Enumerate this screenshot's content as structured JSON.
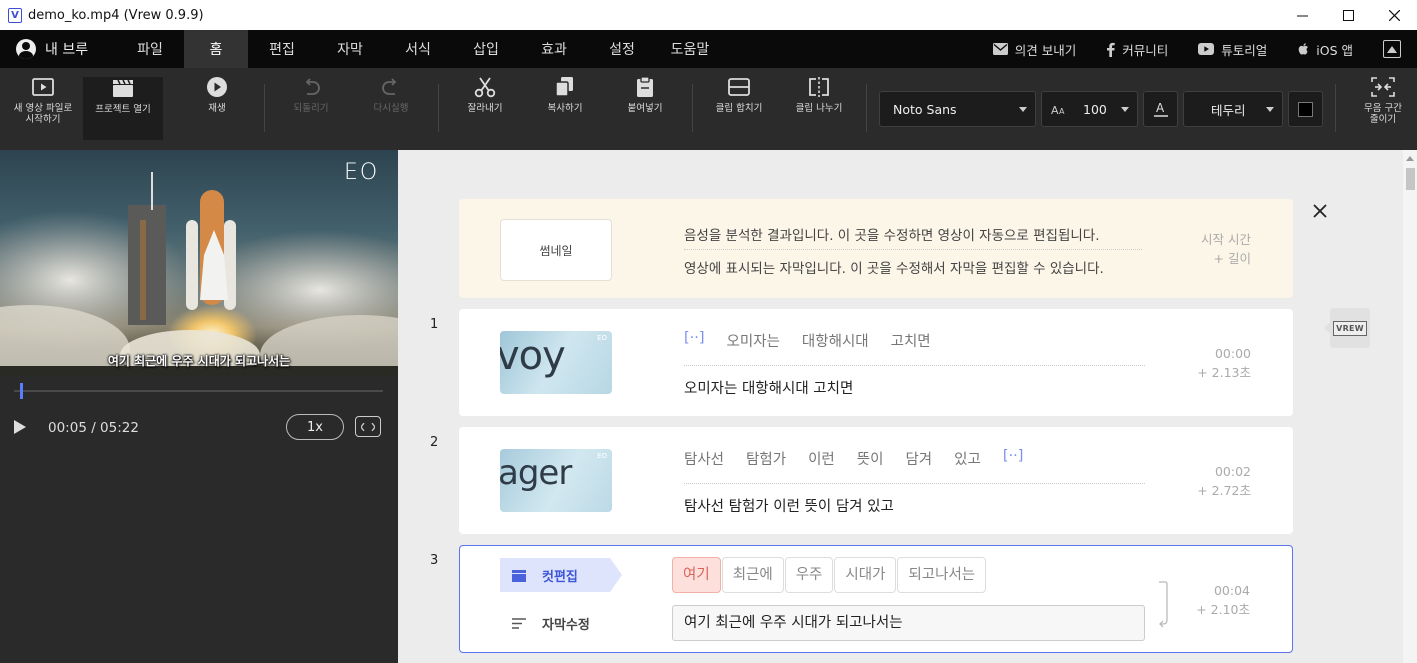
{
  "window": {
    "title": "demo_ko.mp4 (Vrew 0.9.9)",
    "app_icon_letter": "V"
  },
  "menubar": {
    "user_label": "내 브루",
    "items": [
      "파일",
      "홈",
      "편집",
      "자막",
      "서식",
      "삽입",
      "효과",
      "설정",
      "도움말"
    ],
    "active_item": "홈",
    "links": {
      "feedback": "의견 보내기",
      "community": "커뮤니티",
      "tutorial": "튜토리얼",
      "ios_app": "iOS 앱"
    }
  },
  "toolbar": {
    "new_video_line1": "새 영상 파일로",
    "new_video_line2": "시작하기",
    "open_project": "프로젝트 열기",
    "play": "재생",
    "undo": "되돌리기",
    "redo": "다시실행",
    "cut": "잘라내기",
    "copy": "복사하기",
    "paste": "붙여넣기",
    "merge_clip": "클립 합치기",
    "split_clip": "클립 나누기",
    "font_name": "Noto Sans",
    "font_size": "100",
    "outline_label": "테두리",
    "reduce_silence_line1": "무음 구간",
    "reduce_silence_line2": "줄이기"
  },
  "preview": {
    "logo": "EO",
    "subtitle_overlay": "여기 최근에 우주 시대가 되고나서는",
    "time": "00:05 / 05:22",
    "speed": "1x",
    "progress": 0.016
  },
  "editor": {
    "header": {
      "thumbnail_label": "썸네일",
      "line1": "음성을 분석한 결과입니다. 이 곳을 수정하면 영상이 자동으로 편집됩니다.",
      "line2": "영상에 표시되는 자막입니다. 이 곳을 수정해서 자막을 편집할 수 있습니다.",
      "meta_start": "시작 시간",
      "meta_length": "+ 길이"
    },
    "side_badge": "VREW",
    "clips": [
      {
        "number": "1",
        "thumb_text": "voy",
        "thumb_logo": "EO",
        "words": [
          "[··]",
          "오미자는",
          "대항해시대",
          "고치면"
        ],
        "subtitle": "오미자는 대항해시대 고치면",
        "start": "00:00",
        "length": "+ 2.13초"
      },
      {
        "number": "2",
        "thumb_text": "ager",
        "thumb_logo": "EO",
        "words": [
          "탐사선",
          "탐험가",
          "이런",
          "뜻이",
          "담겨",
          "있고",
          "[··]"
        ],
        "subtitle": "탐사선 탐험가 이런 뜻이 담겨 있고",
        "start": "00:02",
        "length": "+ 2.72초"
      },
      {
        "number": "3",
        "cut_edit_label": "컷편집",
        "subtitle_edit_label": "자막수정",
        "words": [
          "여기",
          "최근에",
          "우주",
          "시대가",
          "되고나서는"
        ],
        "subtitle": "여기 최근에 우주 시대가 되고나서는",
        "start": "00:04",
        "length": "+ 2.10초"
      }
    ]
  },
  "colors": {
    "accent": "#5a73f0",
    "menubar_bg": "#0a0a0a",
    "toolbar_bg": "#2b2b2b",
    "header_card_bg": "#fcf6e8",
    "selected_word_bg": "#fde0dc"
  }
}
